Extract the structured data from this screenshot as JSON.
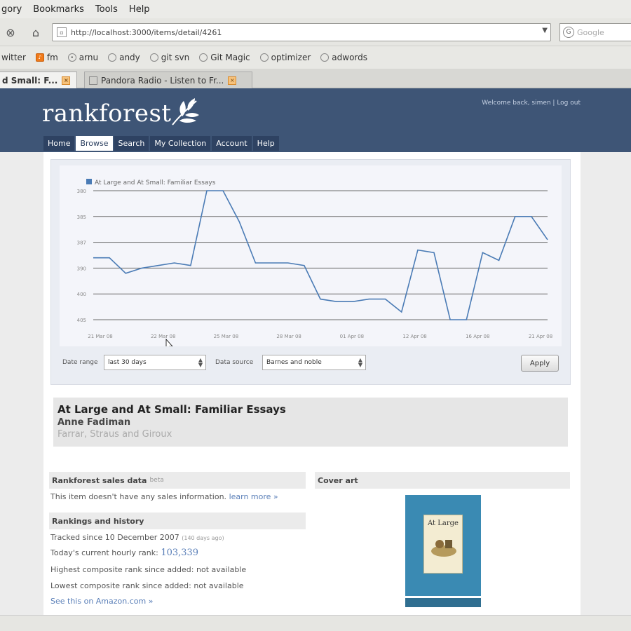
{
  "browser": {
    "menu": [
      "gory",
      "Bookmarks",
      "Tools",
      "Help"
    ],
    "url": "http://localhost:3000/items/detail/4261",
    "search_placeholder": "Google",
    "bookmarks": [
      {
        "label": "witter",
        "icon": "twitter-icon"
      },
      {
        "label": "fm",
        "icon": "lastfm-icon"
      },
      {
        "label": "arnu",
        "icon": "pin-icon"
      },
      {
        "label": "andy",
        "icon": "page-icon"
      },
      {
        "label": "git svn",
        "icon": "page-icon"
      },
      {
        "label": "Git Magic",
        "icon": "page-icon"
      },
      {
        "label": "optimizer",
        "icon": "page-icon"
      },
      {
        "label": "adwords",
        "icon": "page-icon"
      }
    ],
    "tabs": [
      {
        "label": "d Small: F...",
        "active": true
      },
      {
        "label": "Pandora Radio - Listen to Fr...",
        "active": false
      }
    ]
  },
  "site": {
    "logo": "rankforest",
    "welcome": "Welcome back, simen | Log out",
    "nav": [
      {
        "label": "Home",
        "active": false
      },
      {
        "label": "Browse",
        "active": true
      },
      {
        "label": "Search",
        "active": false
      },
      {
        "label": "My Collection",
        "active": false
      },
      {
        "label": "Account",
        "active": false
      },
      {
        "label": "Help",
        "active": false
      }
    ]
  },
  "chart_data": {
    "type": "line",
    "legend": "At Large and At Small: Familiar Essays",
    "y_ticks": [
      "380",
      "385",
      "387",
      "390",
      "400",
      "405"
    ],
    "x_ticks": [
      "21 Mar 08",
      "22 Mar 08",
      "25 Mar 08",
      "28 Mar 08",
      "01 Apr 08",
      "12 Apr 08",
      "16 Apr 08",
      "21 Apr 08"
    ],
    "y_range": [
      0,
      5
    ],
    "series": [
      {
        "values": [
          2.4,
          2.4,
          1.8,
          2.0,
          2.1,
          2.2,
          2.1,
          5.0,
          5.0,
          3.8,
          2.2,
          2.2,
          2.2,
          2.1,
          0.8,
          0.7,
          0.7,
          0.8,
          0.8,
          0.3,
          2.7,
          2.6,
          0.0,
          0.0,
          2.6,
          2.3,
          4.0,
          4.0,
          3.1
        ]
      }
    ]
  },
  "controls": {
    "date_range_label": "Date range",
    "date_range_value": "last 30 days",
    "data_source_label": "Data source",
    "data_source_value": "Barnes and noble",
    "apply": "Apply"
  },
  "book": {
    "title": "At Large and At Small: Familiar Essays",
    "author": "Anne Fadiman",
    "publisher": "Farrar, Straus and Giroux"
  },
  "sales": {
    "heading": "Rankforest sales data",
    "heading_note": "beta",
    "text": "This item doesn't have any sales information.",
    "learn_more": "learn more »"
  },
  "rankings": {
    "heading": "Rankings and history",
    "tracked": "Tracked since 10 December 2007",
    "tracked_note": "(140 days ago)",
    "current_label": "Today's current hourly rank:",
    "current_value": "103,339",
    "highest": "Highest composite rank since added: not available",
    "lowest": "Lowest composite rank since added: not available",
    "amazon_link": "See this on Amazon.com »"
  },
  "cover": {
    "heading": "Cover art",
    "title": "At Large"
  },
  "colors": {
    "header": "#3e5576",
    "line": "#4a7bb5",
    "link": "#5a7fb8"
  }
}
